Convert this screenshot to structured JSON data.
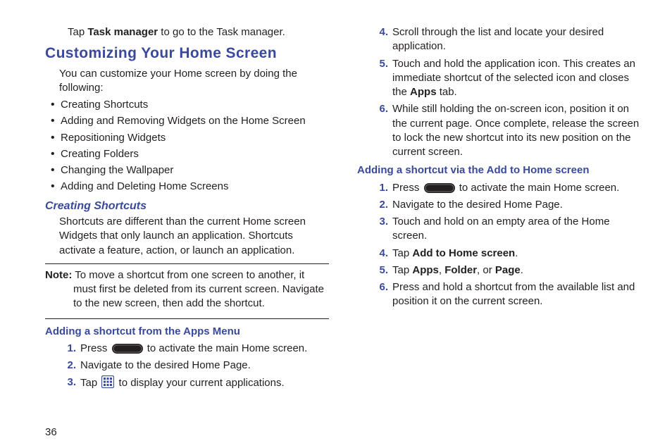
{
  "pageNumber": "36",
  "intro": {
    "pre": "Tap ",
    "bold": "Task manager",
    "post": " to go to the Task manager."
  },
  "heading_customize": "Customizing Your Home Screen",
  "customize_intro": "You can customize your Home screen by doing the following:",
  "bullets": [
    "Creating Shortcuts",
    "Adding and Removing Widgets on the Home Screen",
    "Repositioning Widgets",
    "Creating Folders",
    "Changing the Wallpaper",
    "Adding and Deleting Home Screens"
  ],
  "heading_shortcuts": "Creating Shortcuts",
  "shortcuts_intro": "Shortcuts are different than the current Home screen Widgets that only launch an application. Shortcuts activate a feature, action, or launch an application.",
  "note": {
    "label": "Note:",
    "text": " To move a shortcut from one screen to another, it must first be deleted from its current screen. Navigate to the new screen, then add the shortcut."
  },
  "heading_apps_menu": "Adding a shortcut from the Apps Menu",
  "steps_apps_menu": {
    "s1_pre": "Press ",
    "s1_post": " to activate the main Home screen.",
    "s2": "Navigate to the desired Home Page.",
    "s3_pre": "Tap ",
    "s3_post": " to display your current applications.",
    "s4": "Scroll through the list and locate your desired application.",
    "s5_pre": "Touch and hold the application icon. This creates an immediate shortcut of the selected icon and closes the ",
    "s5_bold": "Apps",
    "s5_post": " tab.",
    "s6": "While still holding the on-screen icon, position it on the current page. Once complete, release the screen to lock the new shortcut into its new position on the current screen."
  },
  "heading_add_home": "Adding a shortcut via the Add to Home screen",
  "steps_add_home": {
    "s1_pre": "Press ",
    "s1_post": " to activate the main Home screen.",
    "s2": "Navigate to the desired Home Page.",
    "s3": "Touch and hold on an empty area of the Home screen.",
    "s4_pre": "Tap ",
    "s4_bold": "Add to Home screen",
    "s4_post": ".",
    "s5_pre": "Tap ",
    "s5_b1": "Apps",
    "s5_sep1": ", ",
    "s5_b2": "Folder",
    "s5_sep2": ", or ",
    "s5_b3": "Page",
    "s5_post": ".",
    "s6": "Press and hold a shortcut from the available list and position it on the current screen."
  }
}
